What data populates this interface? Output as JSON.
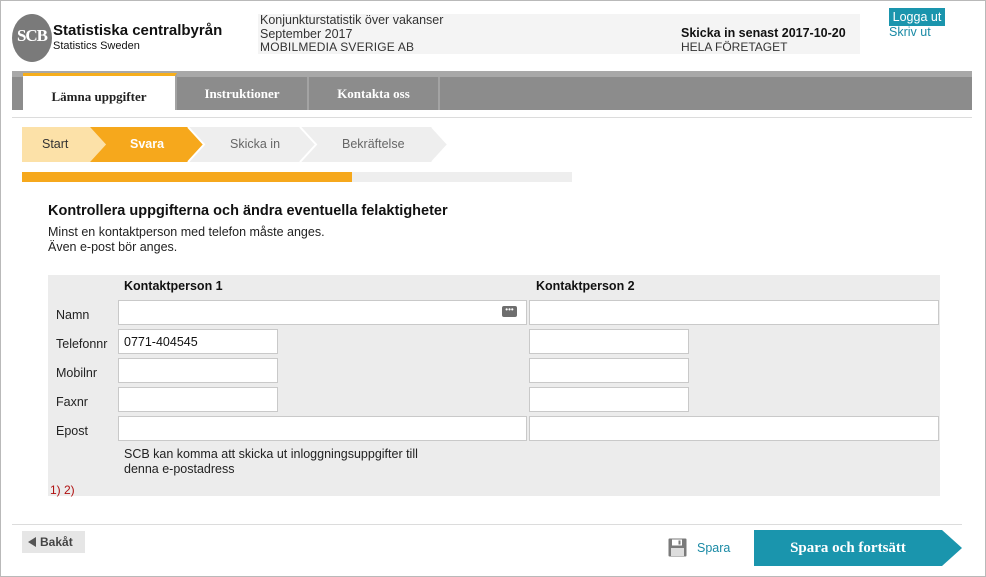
{
  "header": {
    "logo_text": "SCB",
    "org_name": "Statistiska centralbyrån",
    "org_name_en": "Statistics Sweden",
    "survey_title": "Konjunkturstatistik över vakanser",
    "survey_period": "September 2017",
    "company": "MOBILMEDIA SVERIGE AB",
    "deadline": "Skicka in senast 2017-10-20",
    "scope": "HELA FÖRETAGET",
    "logout_label": "Logga ut",
    "print_label": "Skriv ut"
  },
  "nav": {
    "tabs": [
      {
        "label": "Lämna uppgifter",
        "active": true
      },
      {
        "label": "Instruktioner",
        "active": false
      },
      {
        "label": "Kontakta oss",
        "active": false
      }
    ]
  },
  "steps": {
    "items": [
      {
        "label": "Start",
        "state": "done"
      },
      {
        "label": "Svara",
        "state": "current"
      },
      {
        "label": "Skicka in",
        "state": "todo"
      },
      {
        "label": "Bekräftelse",
        "state": "todo"
      }
    ],
    "progress": 0.6
  },
  "content": {
    "heading": "Kontrollera uppgifterna och ändra eventuella felaktigheter",
    "intro_line1": "Minst en kontaktperson med telefon måste anges.",
    "intro_line2": "Även e-post bör anges.",
    "col1_header": "Kontaktperson 1",
    "col2_header": "Kontaktperson 2",
    "rows": {
      "name_label": "Namn",
      "phone_label": "Telefonnr",
      "mobile_label": "Mobilnr",
      "fax_label": "Faxnr",
      "email_label": "Epost"
    },
    "contact1": {
      "name": "",
      "phone": "0771-404545",
      "mobile": "",
      "fax": "",
      "email": ""
    },
    "contact2": {
      "name": "",
      "phone": "",
      "mobile": "",
      "fax": "",
      "email": ""
    },
    "note_line1": "SCB kan komma att skicka ut inloggningsuppgifter till",
    "note_line2": "denna e-postadress",
    "footnotes": "1) 2)"
  },
  "footer": {
    "back_label": "Bakåt",
    "save_label": "Spara",
    "continue_label": "Spara och fortsätt"
  },
  "colors": {
    "accent_orange": "#f6a81c",
    "step_done": "#fce1a8",
    "link_teal": "#1a8aa5",
    "button_teal": "#1a95ad",
    "nav_gray": "#8c8c8c",
    "error_red": "#b01010"
  },
  "icons": {
    "logo": "scb-logo-icon",
    "more": "more-dots-icon",
    "save": "floppy-disk-icon",
    "back": "triangle-left-icon"
  }
}
